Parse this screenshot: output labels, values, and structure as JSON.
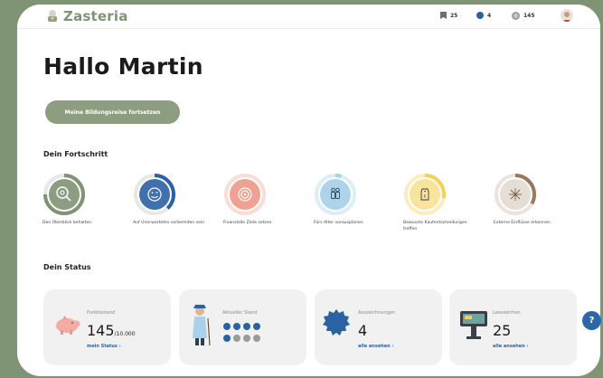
{
  "header": {
    "brand": "Zasteria",
    "bookmarks_count": "25",
    "awards_count": "4",
    "points_count": "145"
  },
  "greeting": "Hallo Martin",
  "cta_label": "Meine Bildungsreise fortsetzen",
  "progress": {
    "title": "Dein Fortschritt",
    "items": [
      {
        "label": "Den Überblick behalten",
        "icon": "magnifier-coins-icon",
        "color": "#7f9474",
        "fraction": 0.75
      },
      {
        "label": "Auf Unerwartetes vorbereiten sein",
        "icon": "smiley-icon",
        "color": "#2b62a3",
        "fraction": 0.38
      },
      {
        "label": "Finanzielle Ziele setzen",
        "icon": "target-icon",
        "color": "#ee9c8c",
        "fraction": 0.0
      },
      {
        "label": "Fürs Alter vorausplanen",
        "icon": "elderly-couple-icon",
        "color": "#a9d2ea",
        "fraction": 0.05
      },
      {
        "label": "Bewusste Kaufentscheidungen treffen",
        "icon": "price-tag-icon",
        "color": "#f3d25a",
        "fraction": 0.28
      },
      {
        "label": "Externe Einflüsse erkennen",
        "icon": "sparkle-icon",
        "color": "#957a5d",
        "fraction": 0.33
      }
    ]
  },
  "status": {
    "title": "Dein Status",
    "points": {
      "title": "Punktestand",
      "value": "145",
      "suffix": "/10.000",
      "link": "mein Status  ›"
    },
    "level": {
      "title": "Aktueller Stand"
    },
    "awards": {
      "title": "Auszeichnungen",
      "value": "4",
      "link": "alle ansehen  ›"
    },
    "bookmarks": {
      "title": "Lesezeichen",
      "value": "25",
      "link": "alle ansehen  ›"
    }
  },
  "help_label": "?"
}
